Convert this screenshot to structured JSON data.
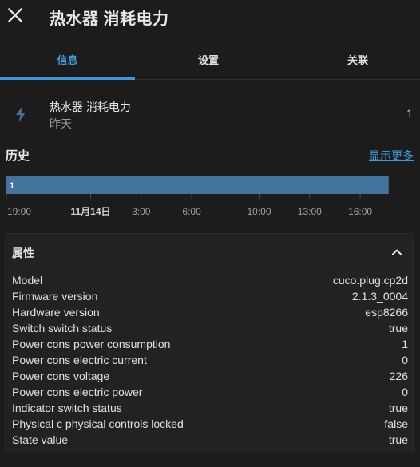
{
  "header": {
    "title": "热水器 消耗电力",
    "close_icon": "close-icon"
  },
  "tabs": [
    {
      "label": "信息",
      "active": true
    },
    {
      "label": "设置",
      "active": false
    },
    {
      "label": "关联",
      "active": false
    }
  ],
  "entity": {
    "icon": "lightning-bolt-icon",
    "name": "热水器 消耗电力",
    "last_changed": "昨天",
    "state": "1"
  },
  "history": {
    "title": "历史",
    "show_more": "显示更多"
  },
  "chart_data": {
    "type": "timeline",
    "bar_color": "#44739e",
    "segments": [
      {
        "label": "1",
        "start": "19:00",
        "end": "17:40"
      }
    ],
    "ticks": [
      "19:00",
      "11月14日",
      "3:00",
      "6:00",
      "10:00",
      "13:00",
      "16:00"
    ],
    "bold_ticks": [
      "11月14日"
    ]
  },
  "attributes": {
    "title": "属性",
    "expanded": true,
    "items": [
      {
        "key": "Model",
        "value": "cuco.plug.cp2d"
      },
      {
        "key": "Firmware version",
        "value": "2.1.3_0004"
      },
      {
        "key": "Hardware version",
        "value": "esp8266"
      },
      {
        "key": "Switch switch status",
        "value": "true"
      },
      {
        "key": "Power cons power consumption",
        "value": "1"
      },
      {
        "key": "Power cons electric current",
        "value": "0"
      },
      {
        "key": "Power cons voltage",
        "value": "226"
      },
      {
        "key": "Power cons electric power",
        "value": "0"
      },
      {
        "key": "Indicator switch status",
        "value": "true"
      },
      {
        "key": "Physical c physical controls locked",
        "value": "false"
      },
      {
        "key": "State value",
        "value": "true"
      }
    ]
  },
  "colors": {
    "accent": "#3a9ad9",
    "background": "#1c1c1c",
    "card": "#222222",
    "text": "#e1e1e1",
    "secondary_text": "#9a9a9a"
  }
}
